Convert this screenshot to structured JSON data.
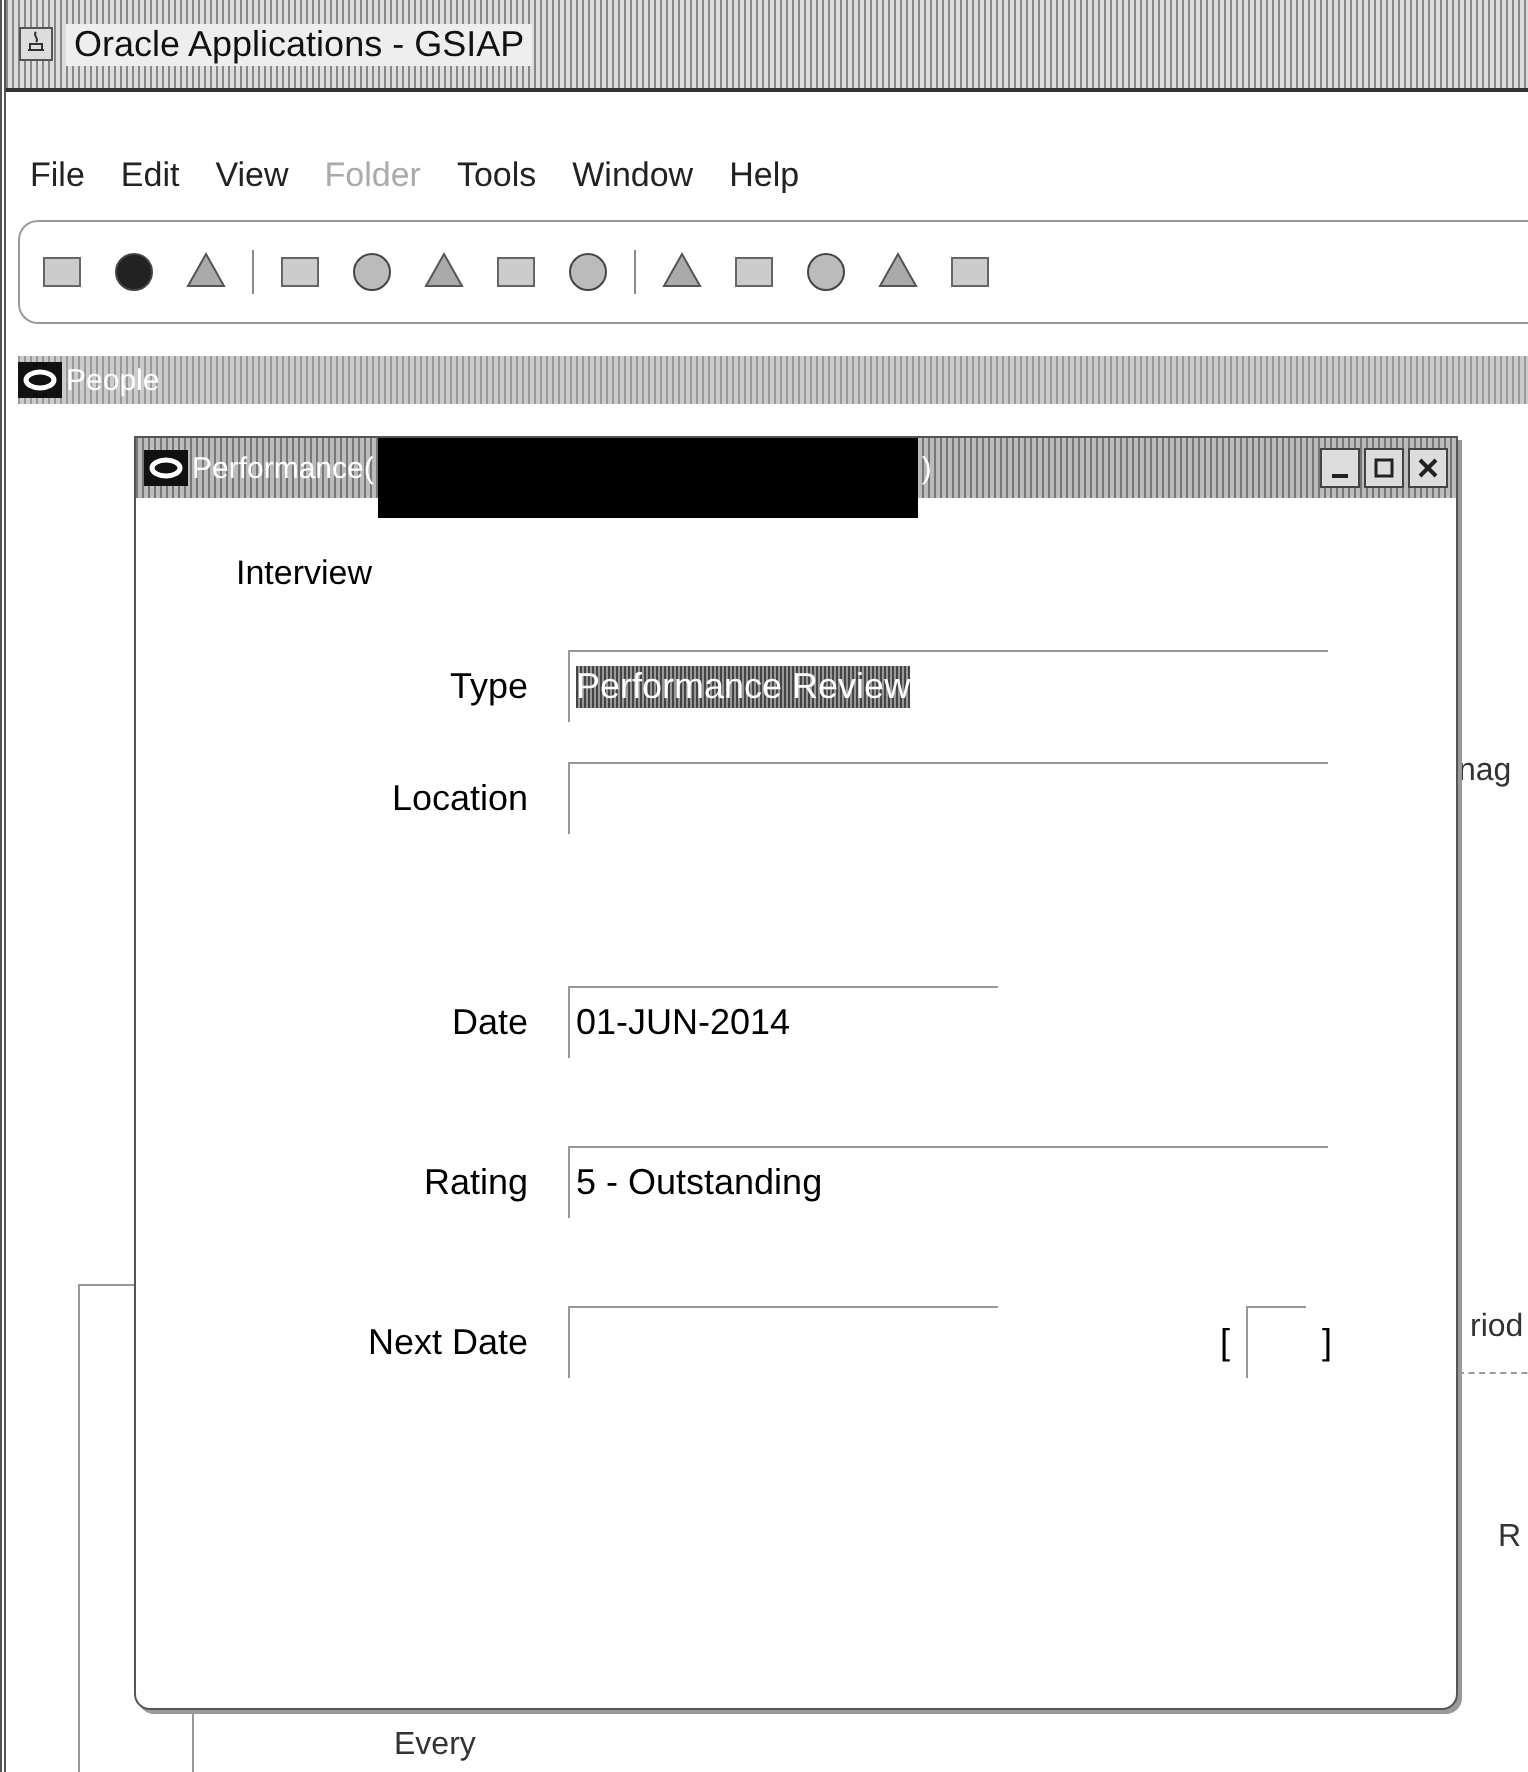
{
  "app_window": {
    "title": "Oracle Applications - GSIAP"
  },
  "menu": [
    {
      "label": "File",
      "disabled": false
    },
    {
      "label": "Edit",
      "disabled": false
    },
    {
      "label": "View",
      "disabled": false
    },
    {
      "label": "Folder",
      "disabled": true
    },
    {
      "label": "Tools",
      "disabled": false
    },
    {
      "label": "Window",
      "disabled": false
    },
    {
      "label": "Help",
      "disabled": false
    }
  ],
  "people_window": {
    "title": "People",
    "fragments": [
      "nag",
      "riod",
      "R",
      "Every"
    ]
  },
  "dialog": {
    "title_start": "Performance(",
    "title_end": ")",
    "section": "Interview",
    "fields": [
      {
        "label": "Type",
        "value": "Performance Review",
        "kind": "long",
        "selected": true
      },
      {
        "label": "Location",
        "kind": "long"
      },
      {
        "label": "Date",
        "value": "01-JUN-2014",
        "kind": "short",
        "selected": false
      },
      {
        "label": "Rating",
        "value": "5 - Outstanding",
        "kind": "long",
        "selected": false
      },
      {
        "label": "Next Date",
        "kind": "short",
        "flex_open": "[",
        "flex_close": "]"
      }
    ]
  }
}
